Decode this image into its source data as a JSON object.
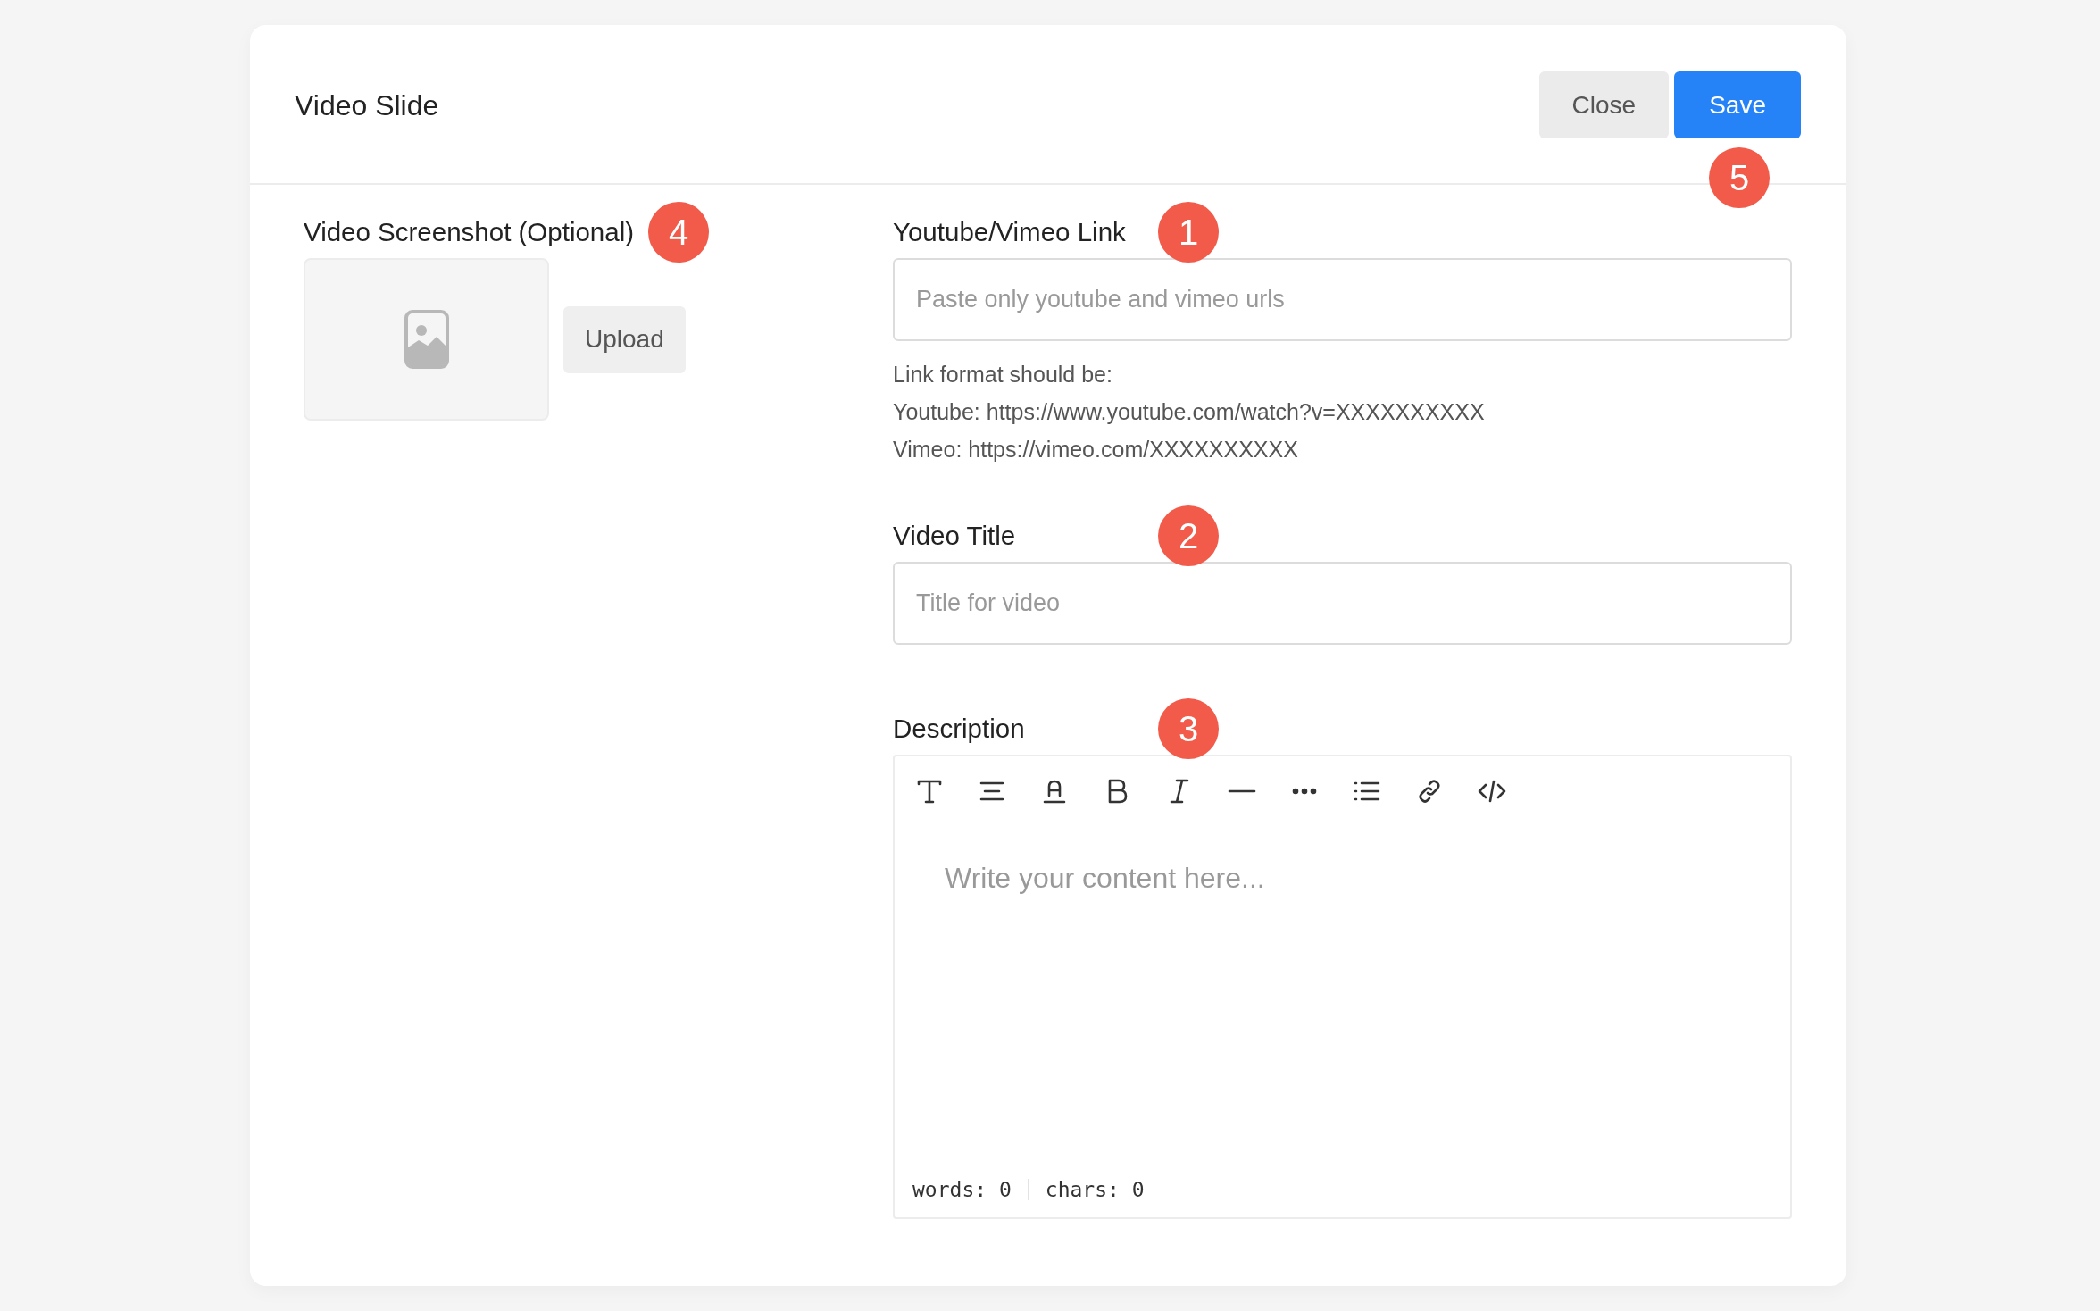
{
  "dialog": {
    "title": "Video Slide",
    "badge": "5",
    "buttons": [
      {
        "label": "Close",
        "kind": "secondary"
      },
      {
        "label": "Save",
        "kind": "primary"
      }
    ]
  },
  "screenshot": {
    "label": "Video Screenshot (Optional)",
    "badge": "4",
    "upload": "Upload"
  },
  "link": {
    "label": "Youtube/Vimeo Link",
    "badge": "1",
    "placeholder": "Paste only youtube and vimeo urls",
    "help": [
      "Link format should be:",
      "Youtube: https://www.youtube.com/watch?v=XXXXXXXXXX",
      "Vimeo: https://vimeo.com/XXXXXXXXXX"
    ]
  },
  "title_field": {
    "label": "Video Title",
    "badge": "2",
    "placeholder": "Title for video"
  },
  "description": {
    "label": "Description",
    "badge": "3",
    "placeholder": "Write your content here...",
    "words": "words: 0",
    "chars": "chars: 0"
  }
}
